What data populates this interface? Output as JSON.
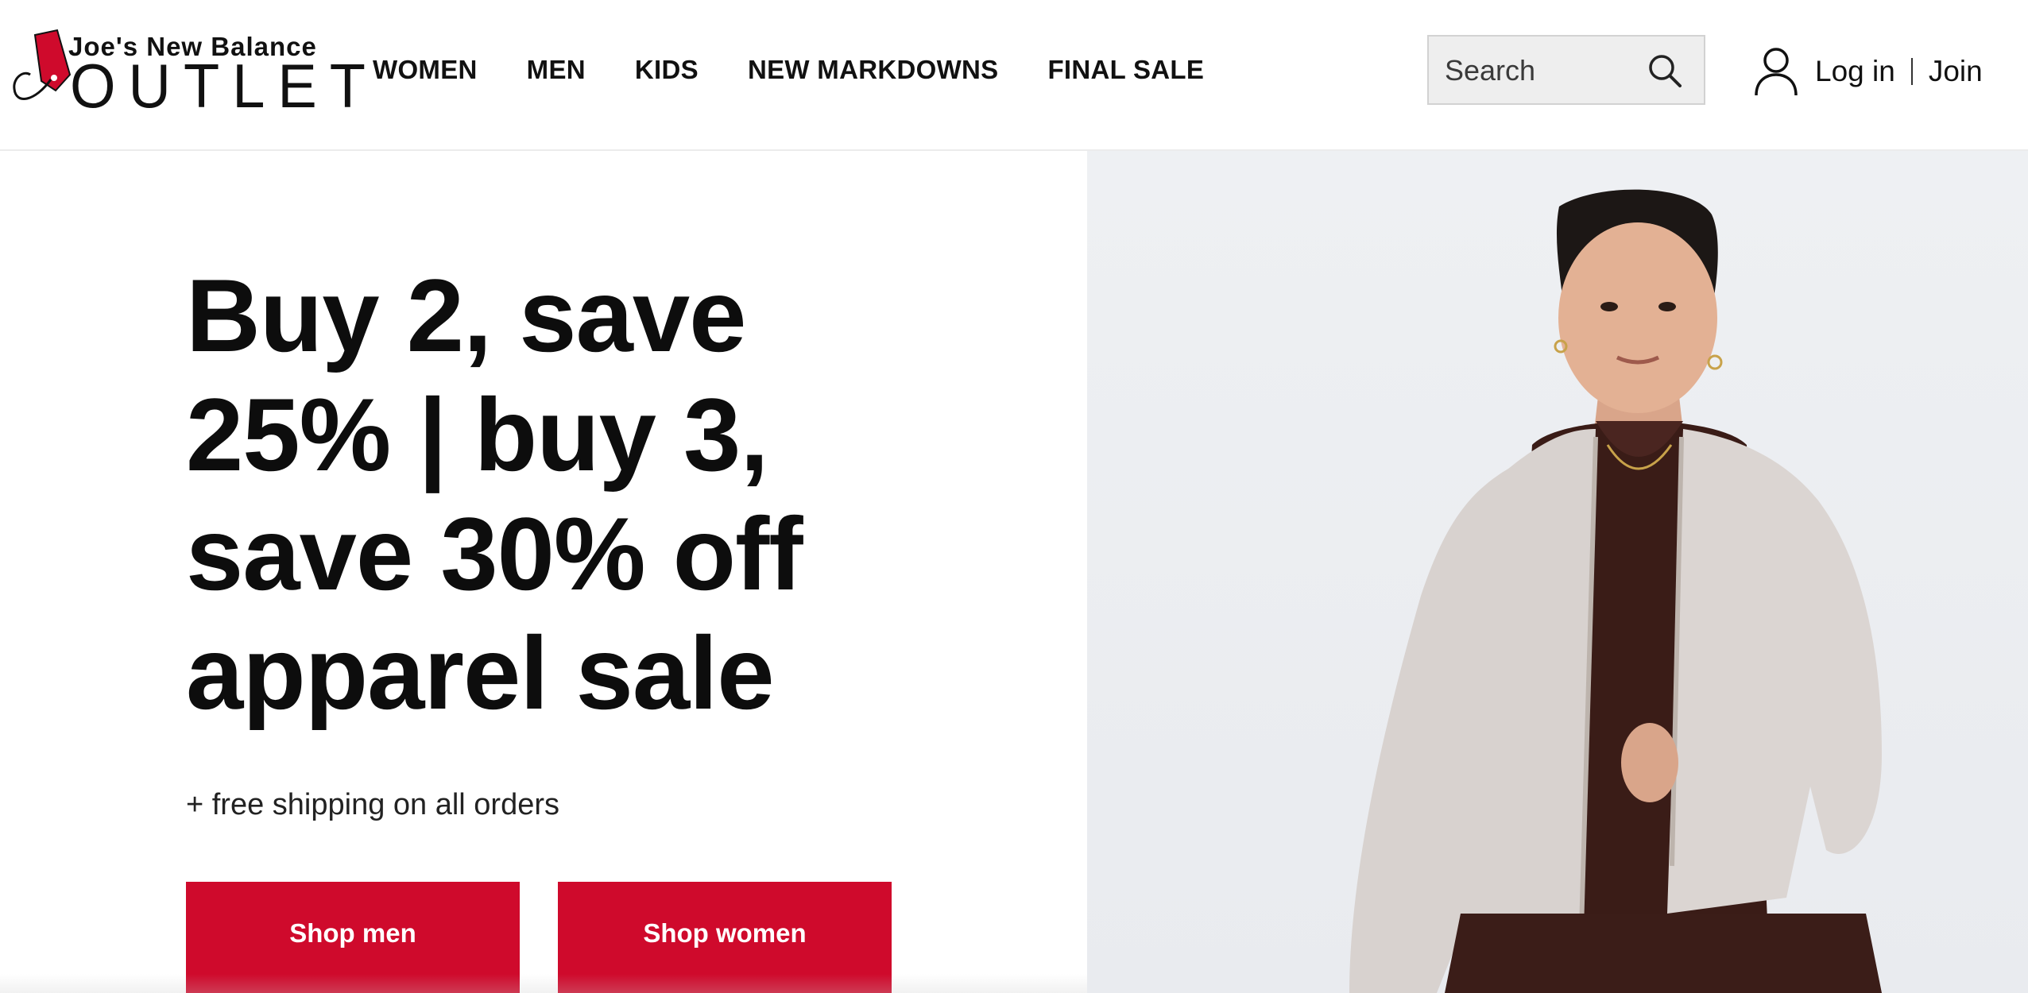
{
  "header": {
    "logo": {
      "line1": "Joe's New Balance",
      "line2": "OUTLET",
      "brand_color": "#cf0a2c"
    },
    "nav": [
      {
        "label": "WOMEN"
      },
      {
        "label": "MEN"
      },
      {
        "label": "KIDS"
      },
      {
        "label": "NEW MARKDOWNS"
      },
      {
        "label": "FINAL SALE"
      }
    ],
    "search": {
      "placeholder": "Search",
      "icon": "search-icon"
    },
    "account": {
      "icon": "user-icon",
      "login_label": "Log in",
      "join_label": "Join"
    }
  },
  "hero": {
    "headline": "Buy 2, save 25% | buy 3, save 30% off apparel sale",
    "subline": "+ free shipping on all orders",
    "buttons": {
      "shop_men": "Shop men",
      "shop_women": "Shop women"
    },
    "button_color": "#cf0a2c",
    "image_description_icon": "model-photo"
  }
}
